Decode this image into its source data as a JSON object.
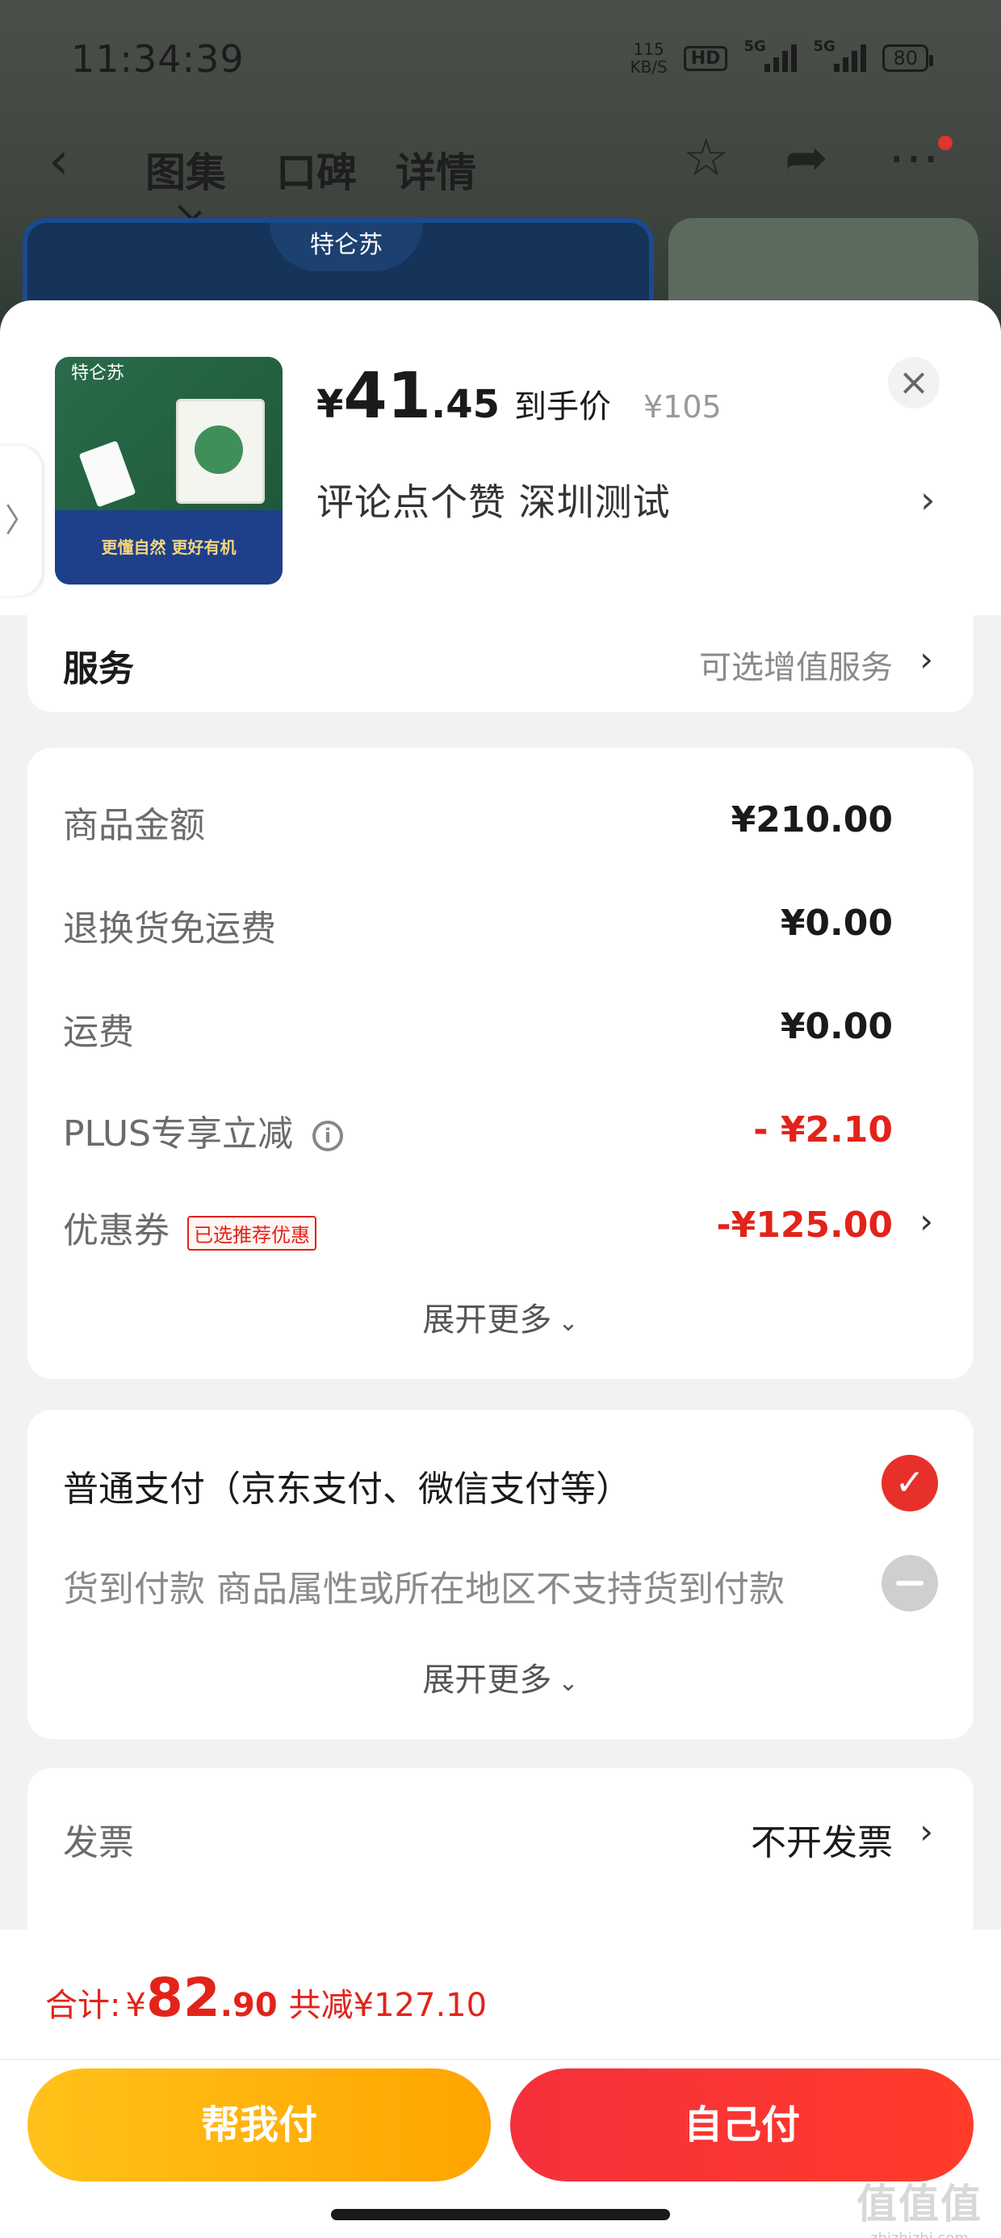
{
  "status_bar": {
    "time": "11:34:39",
    "net_speed_value": "115",
    "net_speed_unit": "KB/S",
    "hd": "HD",
    "signal1": "5G",
    "signal2": "5G",
    "battery": "80"
  },
  "nav": {
    "tabs": [
      "图集",
      "口碑",
      "详情"
    ],
    "active_tab": "图集"
  },
  "banner": {
    "brand": "特仑苏"
  },
  "product": {
    "thumb_brand": "特仑苏",
    "thumb_slogan": "更懂自然 更好有机",
    "price_yen": "¥",
    "price_int": "41",
    "price_dec": ".45",
    "price_label": "到手价",
    "original_price": "¥105",
    "subinfo": "评论点个赞  深圳测试"
  },
  "service": {
    "label": "服务",
    "value": "可选增值服务"
  },
  "amounts": {
    "goods": {
      "label": "商品金额",
      "value": "¥210.00"
    },
    "return_shipping": {
      "label": "退换货免运费",
      "value": "¥0.00"
    },
    "shipping": {
      "label": "运费",
      "value": "¥0.00"
    },
    "plus": {
      "label": "PLUS专享立减",
      "value": "- ¥2.10"
    },
    "coupon": {
      "label": "优惠券",
      "badge": "已选推荐优惠",
      "value": "-¥125.00"
    },
    "expand": "展开更多"
  },
  "payment": {
    "normal": "普通支付（京东支付、微信支付等）",
    "cod": "货到付款 商品属性或所在地区不支持货到付款",
    "expand": "展开更多"
  },
  "invoice": {
    "label": "发票",
    "value": "不开发票"
  },
  "footer": {
    "total_label": "合计:",
    "total_yen": "¥",
    "total_int": "82",
    "total_dec": ".90",
    "total_save": "共减¥127.10",
    "help_pay": "帮我付",
    "self_pay": "自己付"
  },
  "watermark": {
    "main": "值值值",
    "sub": "zhizhizhi.com"
  },
  "colors": {
    "accent_red": "#e2231a",
    "help_button": "#ffb300",
    "self_button": "#f5303c"
  }
}
